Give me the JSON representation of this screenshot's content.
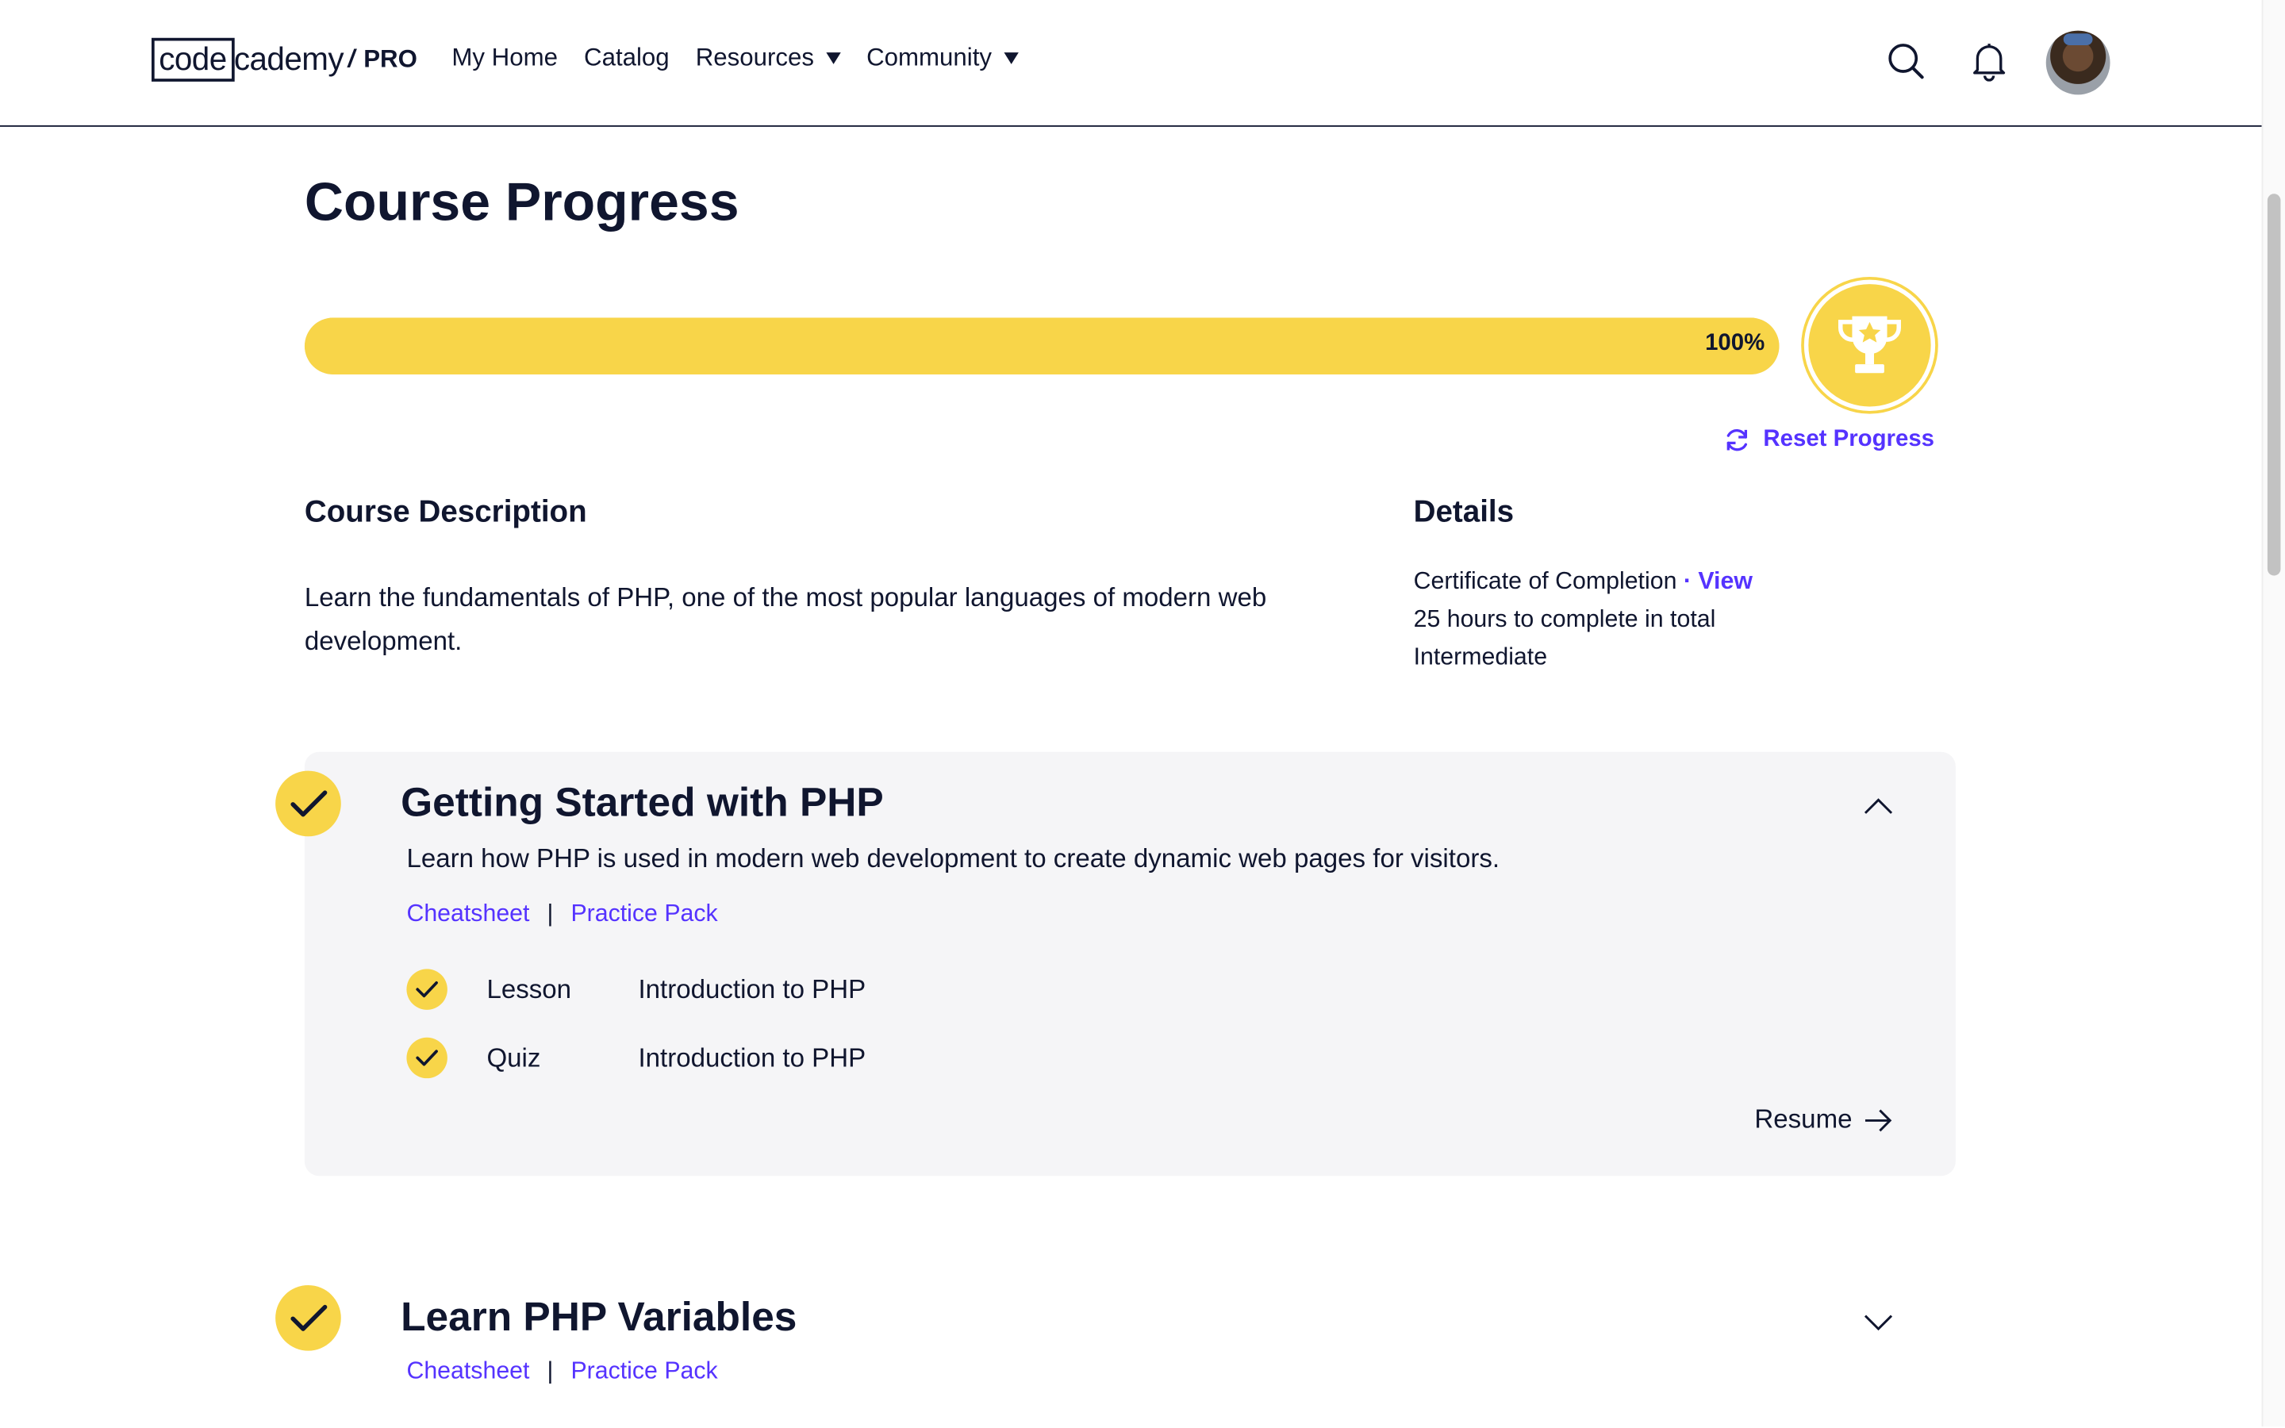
{
  "header": {
    "logo_code": "code",
    "logo_rest": "cademy",
    "logo_slash": "/",
    "logo_pro": "PRO",
    "nav": [
      {
        "label": "My Home"
      },
      {
        "label": "Catalog"
      },
      {
        "label": "Resources"
      },
      {
        "label": "Community"
      }
    ]
  },
  "page": {
    "title": "Course Progress",
    "progress": {
      "percent": 100,
      "label": "100%"
    },
    "reset_label": "Reset Progress"
  },
  "description": {
    "heading": "Course Description",
    "text": "Learn the fundamentals of PHP, one of the most popular languages of modern web development."
  },
  "details": {
    "heading": "Details",
    "certificate": "Certificate of Completion",
    "dot": " · ",
    "view": "View",
    "hours": "25 hours to complete in total",
    "level": "Intermediate"
  },
  "modules": [
    {
      "title": "Getting Started with PHP",
      "description": "Learn how PHP is used in modern web development to create dynamic web pages for visitors.",
      "cheatsheet": "Cheatsheet",
      "separator": "|",
      "practice": "Practice Pack",
      "items": [
        {
          "type": "Lesson",
          "name": "Introduction to PHP"
        },
        {
          "type": "Quiz",
          "name": "Introduction to PHP"
        }
      ],
      "resume": "Resume"
    },
    {
      "title": "Learn PHP Variables",
      "cheatsheet": "Cheatsheet",
      "separator": "|",
      "practice": "Practice Pack"
    }
  ],
  "colors": {
    "accent": "#f8d549",
    "link": "#5533ff",
    "text": "#10162f"
  }
}
